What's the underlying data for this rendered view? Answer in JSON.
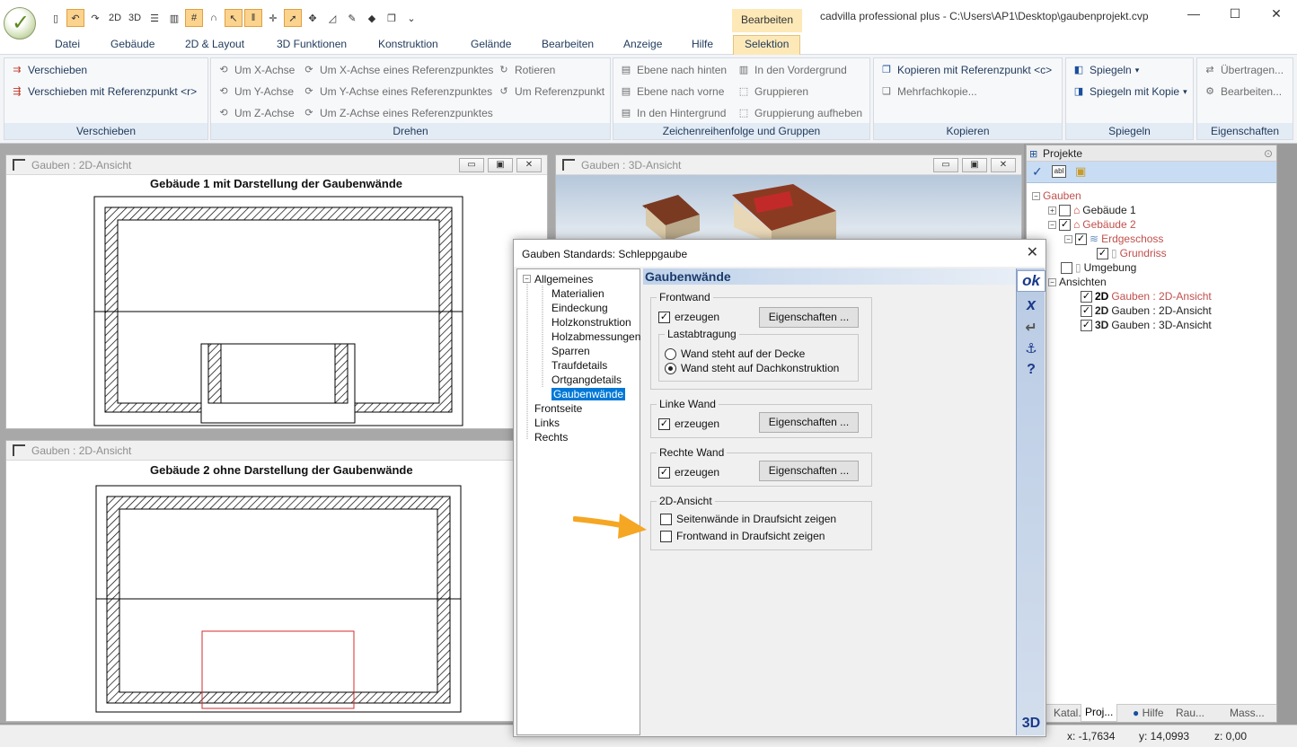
{
  "window": {
    "title": "cadvilla professional plus - C:\\Users\\AP1\\Desktop\\gaubenprojekt.cvp",
    "context_tab_header": "Bearbeiten",
    "minimize": "—",
    "maximize": "☐",
    "close": "✕"
  },
  "ribbon_tabs": [
    "Datei",
    "Gebäude",
    "2D & Layout",
    "3D Funktionen",
    "Konstruktion",
    "Gelände",
    "Bearbeiten",
    "Anzeige",
    "Hilfe",
    "Selektion"
  ],
  "ribbon": {
    "verschieben": {
      "label": "Verschieben",
      "items": [
        "Verschieben",
        "Verschieben mit Referenzpunkt <r>"
      ]
    },
    "drehen": {
      "label": "Drehen",
      "items": [
        "Um X-Achse",
        "Um Y-Achse",
        "Um Z-Achse",
        "Um X-Achse eines Referenzpunktes",
        "Um Y-Achse eines Referenzpunktes",
        "Um Z-Achse eines Referenzpunktes",
        "Rotieren",
        "Um Referenzpunkt"
      ]
    },
    "zeichen": {
      "label": "Zeichenreihenfolge und Gruppen",
      "items": [
        "Ebene nach hinten",
        "Ebene nach vorne",
        "In den Hintergrund",
        "In den Vordergrund",
        "Gruppieren",
        "Gruppierung aufheben"
      ]
    },
    "kopieren": {
      "label": "Kopieren",
      "items": [
        "Kopieren mit Referenzpunkt <c>",
        "Mehrfachkopie..."
      ]
    },
    "spiegeln": {
      "label": "Spiegeln",
      "items": [
        "Spiegeln",
        "Spiegeln mit Kopie"
      ]
    },
    "eigenschaften": {
      "label": "Eigenschaften",
      "items": [
        "Übertragen...",
        "Bearbeiten..."
      ]
    }
  },
  "views": {
    "view1": {
      "title": "Gauben : 2D-Ansicht",
      "drawing_title": "Gebäude 1 mit Darstellung der Gaubenwände"
    },
    "view2": {
      "title": "Gauben : 2D-Ansicht",
      "drawing_title": "Gebäude 2 ohne Darstellung der Gaubenwände"
    },
    "view3": {
      "title": "Gauben : 3D-Ansicht"
    }
  },
  "projekte": {
    "header": "Projekte",
    "tree": {
      "root": "Gauben",
      "gebaeude1": "Gebäude 1",
      "gebaeude2": "Gebäude 2",
      "erdgeschoss": "Erdgeschoss",
      "grundriss": "Grundriss",
      "umgebung": "Umgebung",
      "ansichten": "Ansichten",
      "ansicht1": "Gauben : 2D-Ansicht",
      "ansicht2": "Gauben : 2D-Ansicht",
      "ansicht3": "Gauben : 3D-Ansicht",
      "badge2d": "2D",
      "badge3d": "3D"
    },
    "tabs": [
      "Katal...",
      "Proj...",
      "Hilfe",
      "Rau...",
      "Mass..."
    ]
  },
  "dialog": {
    "title": "Gauben Standards: Schleppgaube",
    "tree": [
      "Allgemeines",
      "Materialien",
      "Eindeckung",
      "Holzkonstruktion",
      "Holzabmessungen",
      "Sparren",
      "Traufdetails",
      "Ortgangdetails",
      "Gaubenwände",
      "Frontseite",
      "Links",
      "Rechts"
    ],
    "heading": "Gaubenwände",
    "frontwand": {
      "legend": "Frontwand",
      "erzeugen": "erzeugen",
      "button": "Eigenschaften ...",
      "lastabtragung": {
        "legend": "Lastabtragung",
        "option1": "Wand steht auf der Decke",
        "option2": "Wand steht auf Dachkonstruktion"
      }
    },
    "linke_wand": {
      "legend": "Linke Wand",
      "erzeugen": "erzeugen",
      "button": "Eigenschaften ..."
    },
    "rechte_wand": {
      "legend": "Rechte Wand",
      "erzeugen": "erzeugen",
      "button": "Eigenschaften ..."
    },
    "ansicht2d": {
      "legend": "2D-Ansicht",
      "option1": "Seitenwände in Draufsicht zeigen",
      "option2": "Frontwand in Draufsicht zeigen"
    },
    "side": {
      "ok": "ok",
      "cancel": "x",
      "apply": "↵",
      "anchor": "⚓",
      "help": "?",
      "three_d": "3D"
    }
  },
  "status": {
    "x": "x: -1,7634",
    "y": "y: 14,0993",
    "z": "z: 0,00"
  },
  "colors": {
    "accent_tab": "#fde9b8",
    "arrow": "#f5a623",
    "red_highlight": "#c0504d",
    "selection": "#0078d7"
  }
}
